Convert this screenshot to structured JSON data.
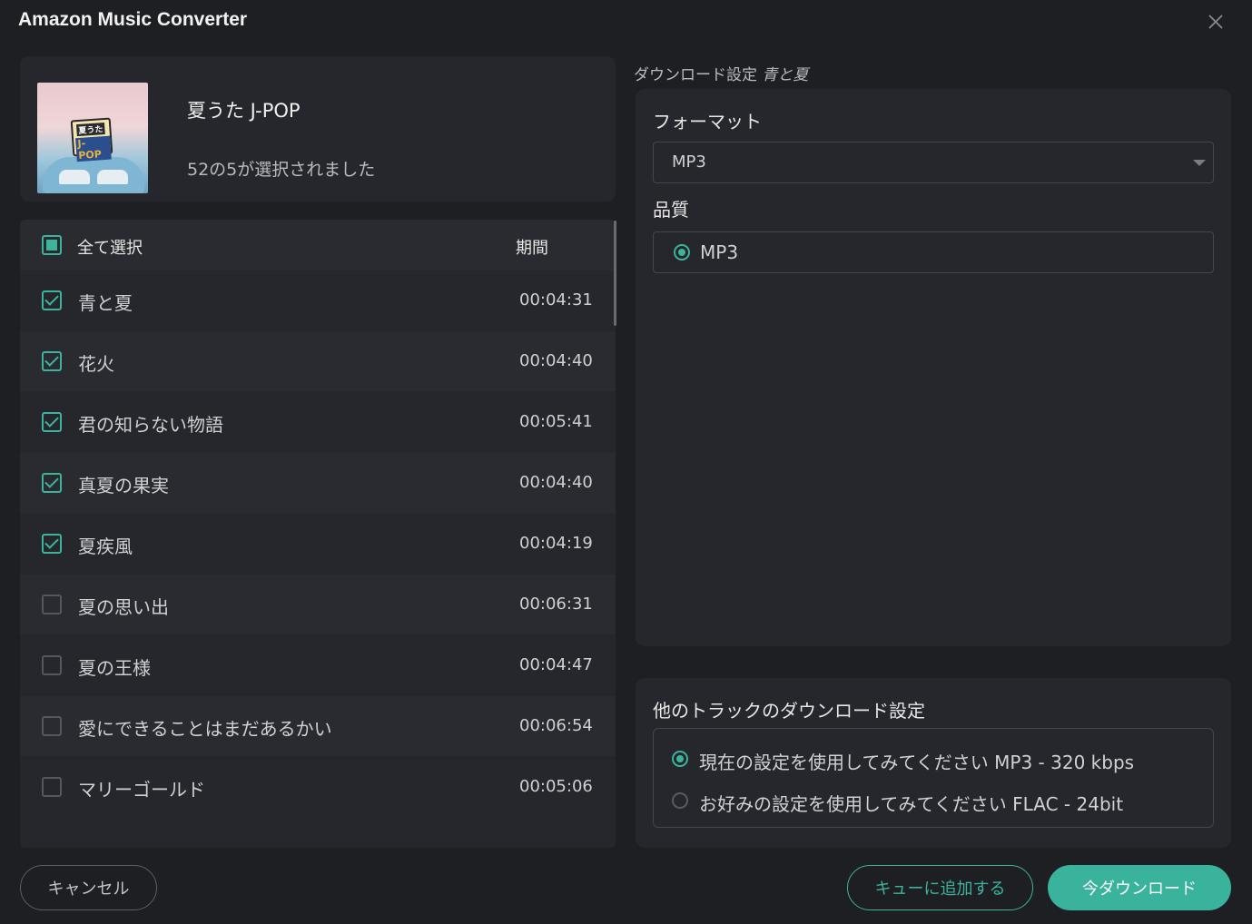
{
  "window": {
    "title": "Amazon Music Converter",
    "close_icon": "close-icon"
  },
  "album": {
    "title": "夏うた J-POP",
    "selection_status": "52の5が選択されました",
    "art_badge_top": "夏うた",
    "art_badge_bottom": "J-POP"
  },
  "track_list": {
    "select_all_label": "全て選択",
    "duration_header": "期間",
    "tracks": [
      {
        "name": "青と夏",
        "duration": "00:04:31",
        "checked": true
      },
      {
        "name": "花火",
        "duration": "00:04:40",
        "checked": true
      },
      {
        "name": "君の知らない物語",
        "duration": "00:05:41",
        "checked": true
      },
      {
        "name": "真夏の果実",
        "duration": "00:04:40",
        "checked": true
      },
      {
        "name": "夏疾風",
        "duration": "00:04:19",
        "checked": true
      },
      {
        "name": "夏の思い出",
        "duration": "00:06:31",
        "checked": false
      },
      {
        "name": "夏の王様",
        "duration": "00:04:47",
        "checked": false
      },
      {
        "name": "愛にできることはまだあるかい",
        "duration": "00:06:54",
        "checked": false
      },
      {
        "name": "マリーゴールド",
        "duration": "00:05:06",
        "checked": false
      }
    ]
  },
  "download_settings": {
    "title_prefix": "ダウンロード設定",
    "title_track": "青と夏",
    "format_label": "フォーマット",
    "format_value": "MP3",
    "quality_label": "品質",
    "quality_value": "MP3"
  },
  "other_tracks": {
    "title": "他のトラックのダウンロード設定",
    "option_current": "現在の設定を使用してみてください MP3 - 320 kbps",
    "option_preferred": "お好みの設定を使用してみてください FLAC - 24bit",
    "selected": "current"
  },
  "buttons": {
    "cancel": "キャンセル",
    "add_to_queue": "キューに追加する",
    "download_now": "今ダウンロード"
  },
  "colors": {
    "accent": "#3db39e",
    "background": "#1e1f23",
    "panel": "#26272c"
  }
}
